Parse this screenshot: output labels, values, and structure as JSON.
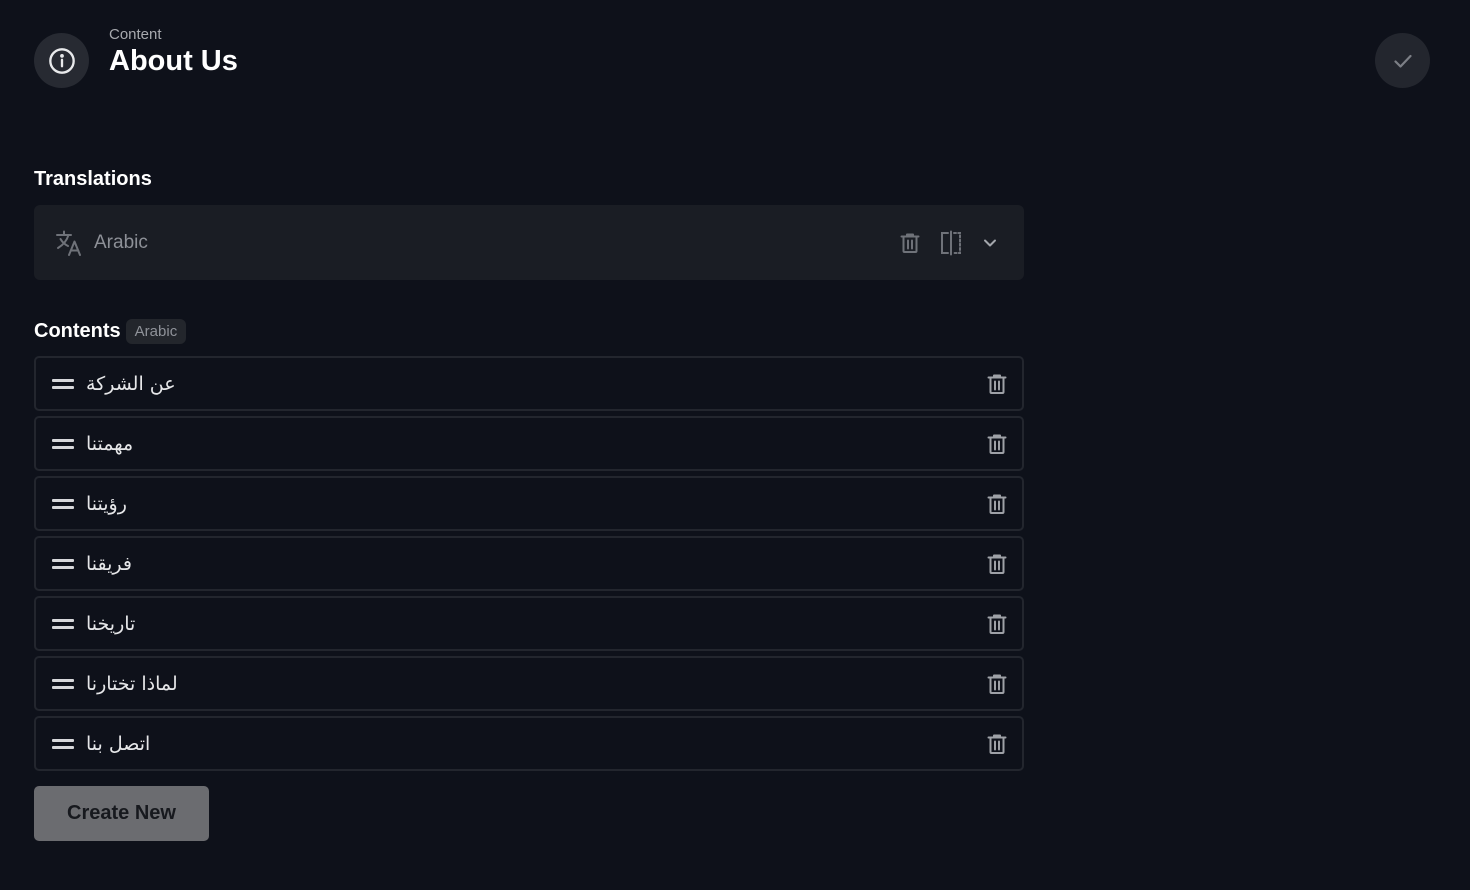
{
  "header": {
    "eyebrow": "Content",
    "title": "About Us",
    "icon": "info-icon",
    "save_icon": "check-icon"
  },
  "translations": {
    "label": "Translations",
    "selected_language": "Arabic",
    "icons": [
      "translate-icon",
      "trash-icon",
      "split-view-icon",
      "chevron-down-icon"
    ]
  },
  "contents": {
    "label": "Contents",
    "language_badge": "Arabic",
    "items": [
      {
        "label": "عن الشركة"
      },
      {
        "label": "مهمتنا"
      },
      {
        "label": "رؤيتنا"
      },
      {
        "label": "فريقنا"
      },
      {
        "label": "تاريخنا"
      },
      {
        "label": "لماذا تختارنا"
      },
      {
        "label": "اتصل بنا"
      }
    ]
  },
  "actions": {
    "create_label": "Create New"
  },
  "colors": {
    "background": "#0e111a",
    "panel": "#1a1d24",
    "border": "#23262e",
    "muted_text": "#8d9097",
    "button_bg": "#6b6c70"
  }
}
